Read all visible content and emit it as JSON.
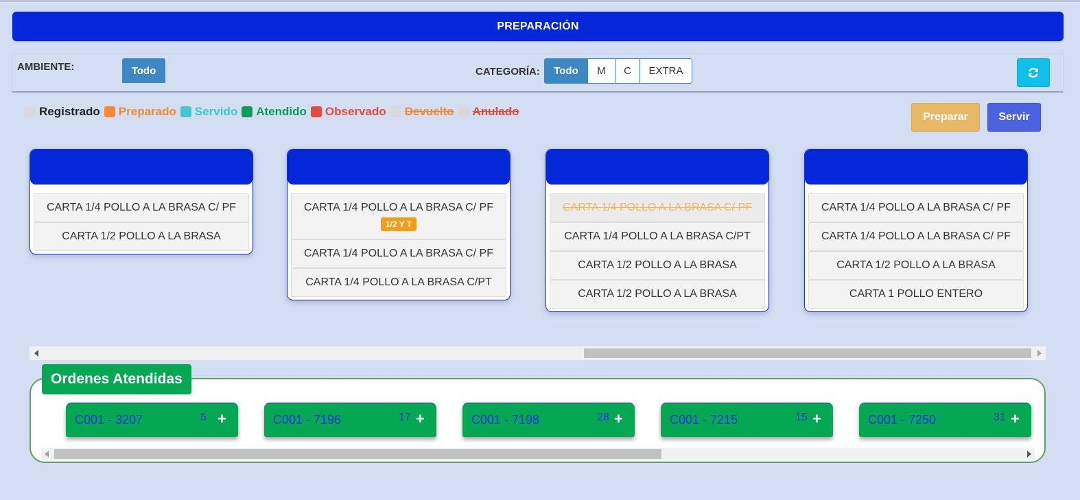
{
  "header": {
    "title": "PREPARACIÓN"
  },
  "filters": {
    "ambiente_label": "AMBIENTE:",
    "ambiente_todo": "Todo",
    "categoria_label": "CATEGORÍA:",
    "categorias": [
      "Todo",
      "M",
      "C",
      "EXTRA"
    ],
    "categoria_selected": "Todo",
    "refresh_icon": "refresh-icon"
  },
  "legend": [
    {
      "label": "Registrado",
      "color": "#d9d9d9",
      "text_color": "#222222"
    },
    {
      "label": "Preparado",
      "color": "#f7882f",
      "text_color": "#f7882f"
    },
    {
      "label": "Servido",
      "color": "#3fc7cf",
      "text_color": "#3fc7cf"
    },
    {
      "label": "Atendido",
      "color": "#0a9c58",
      "text_color": "#0a9c58"
    },
    {
      "label": "Observado",
      "color": "#e24c3b",
      "text_color": "#e24c3b"
    },
    {
      "label": "Devuelto",
      "color": "#d9d9d9",
      "text_color": "#f7882f"
    },
    {
      "label": "Anulado",
      "color": "#d9d9d9",
      "text_color": "#e24c3b"
    }
  ],
  "actions": {
    "preparar": "Preparar",
    "servir": "Servir"
  },
  "orders": [
    {
      "items": [
        {
          "name": "CARTA 1/4 POLLO A LA BRASA C/ PF"
        },
        {
          "name": "CARTA 1/2 POLLO A LA BRASA"
        }
      ]
    },
    {
      "items": [
        {
          "name": "CARTA 1/4 POLLO A LA BRASA C/ PF",
          "tag": "1/2 Y T"
        },
        {
          "name": "CARTA 1/4 POLLO A LA BRASA C/ PF"
        },
        {
          "name": "CARTA 1/4 POLLO A LA BRASA C/PT"
        }
      ]
    },
    {
      "items": [
        {
          "name": "CARTA 1/4 POLLO A LA BRASA C/ PF",
          "status": "cancelled"
        },
        {
          "name": "CARTA 1/4 POLLO A LA BRASA C/PT"
        },
        {
          "name": "CARTA 1/2 POLLO A LA BRASA"
        },
        {
          "name": "CARTA 1/2 POLLO A LA BRASA"
        }
      ]
    },
    {
      "items": [
        {
          "name": "CARTA 1/4 POLLO A LA BRASA C/ PF"
        },
        {
          "name": "CARTA 1/4 POLLO A LA BRASA C/ PF"
        },
        {
          "name": "CARTA 1/2 POLLO A LA BRASA"
        },
        {
          "name": "CARTA 1 POLLO ENTERO"
        }
      ]
    }
  ],
  "atendidas": {
    "title": "Ordenes Atendidas",
    "orders": [
      {
        "code": "C001 - 3207",
        "count": "5"
      },
      {
        "code": "C001 - 7196",
        "count": "17"
      },
      {
        "code": "C001 - 7198",
        "count": "28"
      },
      {
        "code": "C001 - 7215",
        "count": "15"
      },
      {
        "code": "C001 - 7250",
        "count": "31"
      }
    ],
    "plus": "+"
  }
}
